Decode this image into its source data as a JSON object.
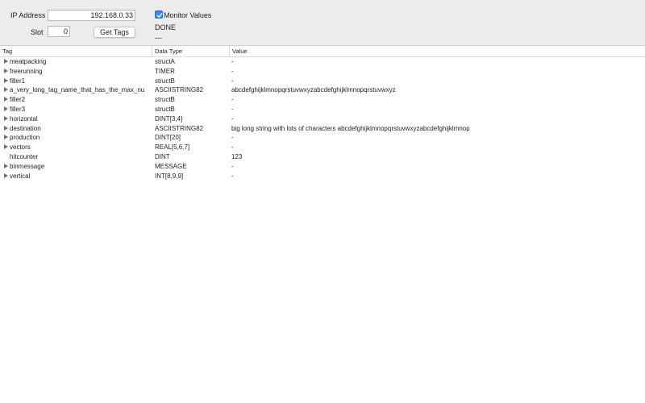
{
  "controls": {
    "ip_label": "IP Address",
    "ip_value": "192.168.0.33",
    "slot_label": "Slot",
    "slot_value": "0",
    "get_tags_label": "Get Tags",
    "monitor_label": "Monitor Values",
    "monitor_checked": true,
    "status_text": "DONE",
    "substatus_text": "---"
  },
  "table": {
    "columns": [
      "Tag",
      "Data Type",
      "Value"
    ],
    "rows": [
      {
        "tag": "meatpacking",
        "type": "structA",
        "value": "-",
        "expandable": true
      },
      {
        "tag": "freerunning",
        "type": "TIMER",
        "value": "-",
        "expandable": true
      },
      {
        "tag": "filler1",
        "type": "structB",
        "value": "-",
        "expandable": true
      },
      {
        "tag": "a_very_long_tag_name_that_has_the_max_nu",
        "type": "ASCIISTRING82",
        "value": "abcdefghijklmnopqrstuvwxyzabcdefghijklmnopqrstuvwxyz",
        "expandable": true
      },
      {
        "tag": "filler2",
        "type": "structB",
        "value": "-",
        "expandable": true
      },
      {
        "tag": "filler3",
        "type": "structB",
        "value": "-",
        "expandable": true
      },
      {
        "tag": "horizontal",
        "type": "DINT[3,4]",
        "value": "-",
        "expandable": true
      },
      {
        "tag": "destination",
        "type": "ASCIISTRING82",
        "value": "big long string with lots of characters abcdefghijklmnopqrstuvwxyzabcdefghijklmnop",
        "expandable": true
      },
      {
        "tag": "production",
        "type": "DINT[20]",
        "value": "-",
        "expandable": true
      },
      {
        "tag": "vectors",
        "type": "REAL[5,6,7]",
        "value": "-",
        "expandable": true
      },
      {
        "tag": "hitcounter",
        "type": "DINT",
        "value": "123",
        "expandable": false
      },
      {
        "tag": "binmessage",
        "type": "MESSAGE",
        "value": "-",
        "expandable": true
      },
      {
        "tag": "vertical",
        "type": "INT[8,9,9]",
        "value": "-",
        "expandable": true
      }
    ]
  },
  "colors": {
    "panel_background": "#ececec",
    "checkbox_accent": "#3b82f7",
    "disclosure_triangle": "#707070"
  },
  "icons": {
    "disclosure": "disclosure-triangle-right-icon",
    "checkmark": "checkmark-icon"
  }
}
